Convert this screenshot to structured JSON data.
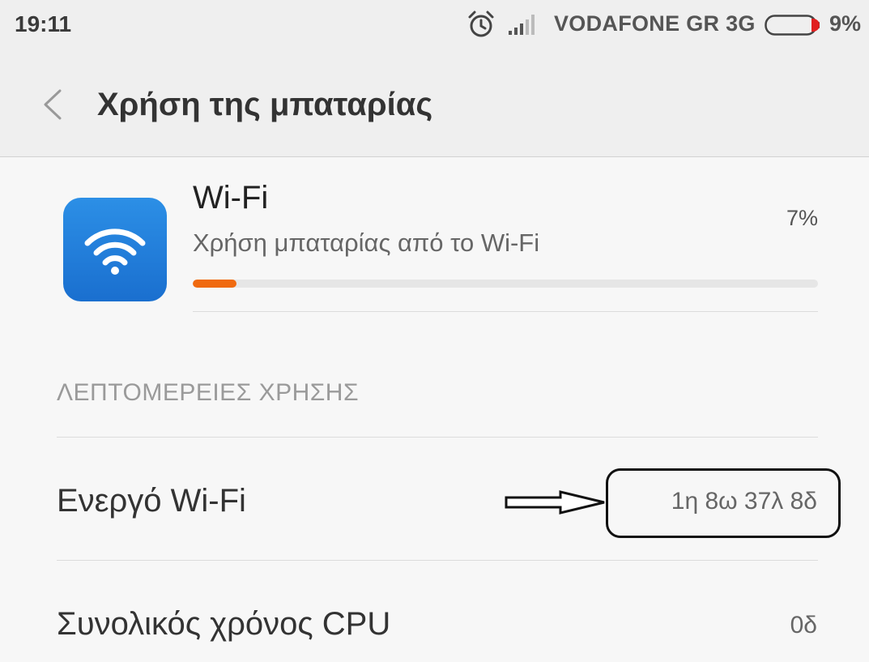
{
  "status_bar": {
    "time": "19:11",
    "carrier": "VODAFONE GR 3G",
    "battery_percent": "9%",
    "battery_level": 0.09,
    "icons": [
      "alarm-clock-icon",
      "signal-strength-icon",
      "battery-icon"
    ]
  },
  "header": {
    "title": "Χρήση της μπαταρίας",
    "back_icon": "chevron-left-icon"
  },
  "app": {
    "name": "Wi-Fi",
    "description": "Χρήση μπαταρίας από το Wi-Fi",
    "percent": "7%",
    "usage_fraction": 0.07,
    "icon": "wifi-icon",
    "accent_color": "#f06a0f",
    "icon_color": "#1f7fdc"
  },
  "details": {
    "section_title": "ΛΕΠΤΟΜΕΡΕΙΕΣ ΧΡΗΣΗΣ",
    "rows": [
      {
        "label": "Ενεργό Wi-Fi",
        "value": "1η 8ω 37λ 8δ"
      },
      {
        "label": "Συνολικός χρόνος CPU",
        "value": "0δ"
      }
    ]
  }
}
